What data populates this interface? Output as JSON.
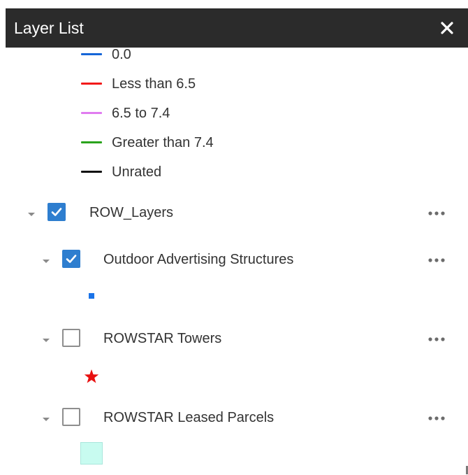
{
  "panel": {
    "title": "Layer List",
    "close_icon": "close-icon"
  },
  "legend": {
    "items": [
      {
        "label": "0.0",
        "color": "#1565d8"
      },
      {
        "label": "Less than 6.5",
        "color": "#f21a1a"
      },
      {
        "label": "6.5 to 7.4",
        "color": "#e07cf0"
      },
      {
        "label": "Greater than 7.4",
        "color": "#2aa31c"
      },
      {
        "label": "Unrated",
        "color": "#111111"
      }
    ]
  },
  "layers": {
    "group": {
      "label": "ROW_Layers",
      "checked": true,
      "expanded": true
    },
    "items": [
      {
        "label": "Outdoor Advertising Structures",
        "checked": true,
        "expanded": true,
        "symbol": "blue-square-marker"
      },
      {
        "label": "ROWSTAR Towers",
        "checked": false,
        "expanded": true,
        "symbol": "red-star-marker"
      },
      {
        "label": "ROWSTAR Leased Parcels",
        "checked": false,
        "expanded": true,
        "symbol": "light-cyan-fill"
      }
    ]
  },
  "colors": {
    "header_bg": "#2b2b2b",
    "checkbox_checked": "#2e7ecf",
    "star": "#e81010",
    "square_marker": "#1a73e8",
    "parcel_fill": "#c8fbf0"
  }
}
